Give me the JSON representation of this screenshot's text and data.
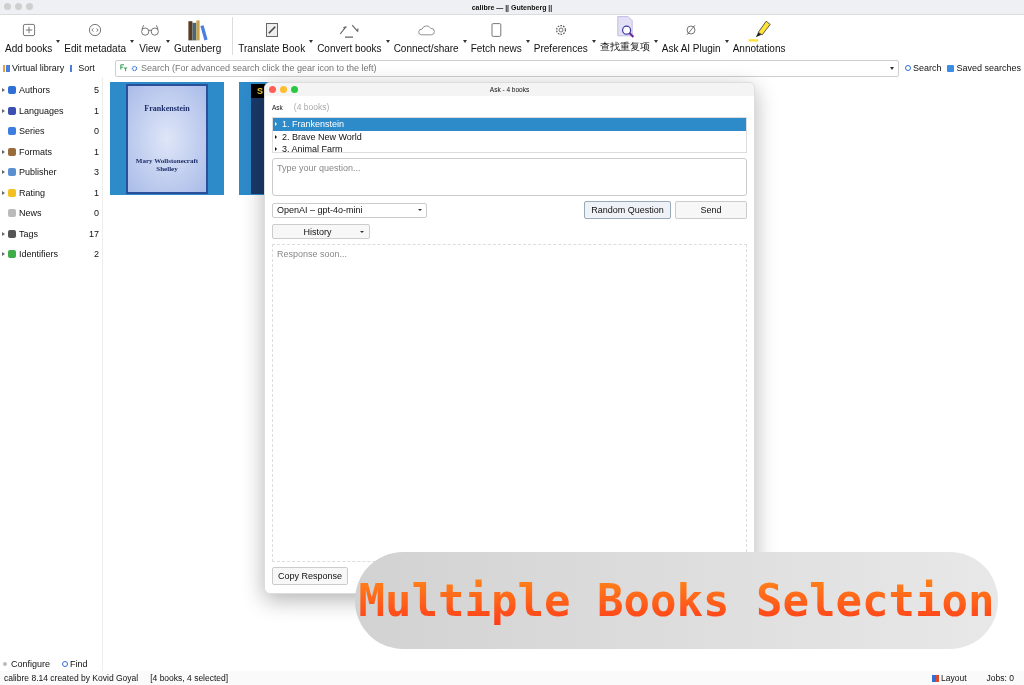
{
  "window": {
    "title": "calibre — || Gutenberg ||"
  },
  "toolbar": [
    {
      "label": "Add books",
      "menu": true
    },
    {
      "label": "Edit metadata",
      "menu": true
    },
    {
      "label": "View",
      "menu": true
    },
    {
      "label": "Gutenberg",
      "menu": false
    },
    {
      "label": "Translate Book",
      "menu": true
    },
    {
      "label": "Convert books",
      "menu": true
    },
    {
      "label": "Connect/share",
      "menu": true
    },
    {
      "label": "Fetch news",
      "menu": true
    },
    {
      "label": "Preferences",
      "menu": true
    },
    {
      "label": "查找重复项",
      "menu": true
    },
    {
      "label": "Ask AI Plugin",
      "menu": true
    },
    {
      "label": "Annotations",
      "menu": false
    }
  ],
  "search_bar": {
    "virtual_library": "Virtual library",
    "sort": "Sort",
    "placeholder": "Search (For advanced search click the gear icon to the left)",
    "search": "Search",
    "saved_searches": "Saved searches"
  },
  "sidebar": {
    "items": [
      {
        "label": "Authors",
        "count": "5",
        "expandable": true,
        "color": "#2f6fd6"
      },
      {
        "label": "Languages",
        "count": "1",
        "expandable": true,
        "color": "#3a4fb0"
      },
      {
        "label": "Series",
        "count": "0",
        "expandable": false,
        "color": "#3c7de0"
      },
      {
        "label": "Formats",
        "count": "1",
        "expandable": true,
        "color": "#9a6b3a"
      },
      {
        "label": "Publisher",
        "count": "3",
        "expandable": true,
        "color": "#5a8fd0"
      },
      {
        "label": "Rating",
        "count": "1",
        "expandable": true,
        "color": "#f2c021"
      },
      {
        "label": "News",
        "count": "0",
        "expandable": false,
        "color": "#bbbbbb"
      },
      {
        "label": "Tags",
        "count": "17",
        "expandable": true,
        "color": "#555555"
      },
      {
        "label": "Identifiers",
        "count": "2",
        "expandable": true,
        "color": "#3fae4a"
      }
    ],
    "configure": "Configure",
    "find": "Find"
  },
  "books": [
    {
      "title": "Frankenstein",
      "author": "Mary Wollstonecraft Shelley",
      "selected": true
    },
    {
      "title": "S",
      "selected": true
    }
  ],
  "dialog": {
    "title": "Ask - 4 books",
    "heading": "Ask",
    "count": "(4 books)",
    "book_list": [
      {
        "label": "1. Frankenstein",
        "selected": true
      },
      {
        "label": "2. Brave New World",
        "selected": false
      },
      {
        "label": "3. Animal Farm",
        "selected": false
      }
    ],
    "question_placeholder": "Type your question...",
    "model": "OpenAI – gpt-4o-mini",
    "random_question": "Random Question",
    "send": "Send",
    "history": "History",
    "response_placeholder": "Response soon...",
    "buttons": [
      "Copy Response"
    ]
  },
  "caption": "Multiple Books Selection",
  "status_bar": {
    "left": "calibre 8.14 created by Kovid Goyal",
    "selection": "[4 books, 4 selected]",
    "layout": "Layout",
    "jobs": "Jobs: 0"
  }
}
